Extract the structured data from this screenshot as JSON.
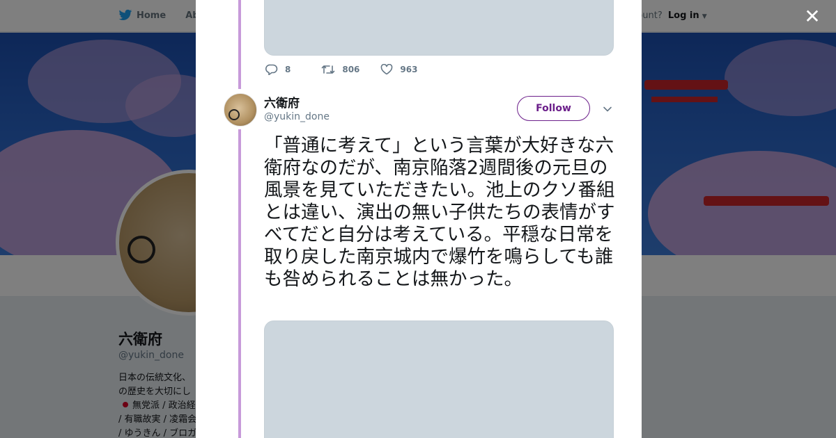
{
  "topbar": {
    "home_label": "Home",
    "about_label": "Abo",
    "account_prompt": "ccount?",
    "login_label": "Log in"
  },
  "profile": {
    "name": "六衛府",
    "handle": "@yukin_done",
    "bio_lines": [
      "日本の伝統文化、",
      "の歴史を大切にし",
      "無党派 / 政治経",
      "/ 有職故実 / 凌霜会",
      "/ ゆうきん / ブロガ"
    ]
  },
  "modal": {
    "previous_tweet": {
      "replies": "8",
      "retweets": "806",
      "likes": "963"
    },
    "tweet": {
      "author_name": "六衛府",
      "author_handle": "@yukin_done",
      "follow_label": "Follow",
      "text": "「普通に考えて」という言葉が大好きな六衛府なのだが、南京陥落2週間後の元旦の風景を見ていただきたい。池上のクソ番組とは違い、演出の無い子供たちの表情がすべてだと自分は考えている。平穏な日常を取り戻した南京城内で爆竹を鳴らしても誰も咎められることは無かった。"
    }
  },
  "icons": {
    "close": "close-icon",
    "reply": "reply-icon",
    "retweet": "retweet-icon",
    "like": "heart-icon",
    "more": "chevron-down-icon",
    "logo": "twitter-bird-icon"
  },
  "colors": {
    "accent": "#6b1e8a",
    "thread_line": "#c79ad9",
    "media_placeholder": "#ccd6dd"
  }
}
